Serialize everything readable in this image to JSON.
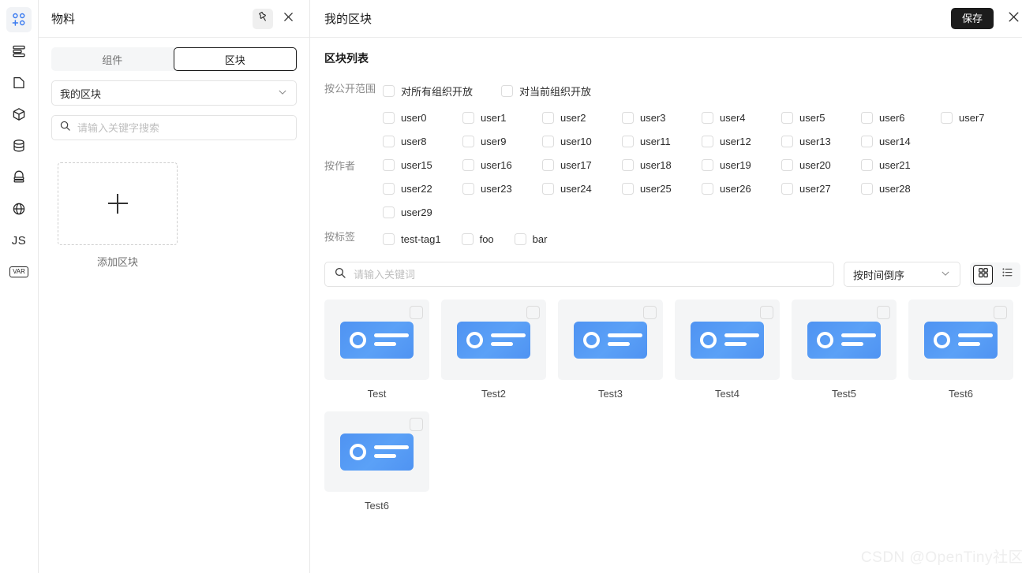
{
  "rail": {
    "items": [
      {
        "name": "material-add-icon",
        "label": "",
        "active": true
      },
      {
        "name": "layers-outline-icon",
        "label": "",
        "active": false
      },
      {
        "name": "page-icon",
        "label": "",
        "active": false
      },
      {
        "name": "cube-icon",
        "label": "",
        "active": false
      },
      {
        "name": "database-icon",
        "label": "",
        "active": false
      },
      {
        "name": "stack-icon",
        "label": "",
        "active": false
      },
      {
        "name": "globe-icon",
        "label": "",
        "active": false
      },
      {
        "name": "js-icon",
        "label": "JS",
        "active": false
      },
      {
        "name": "var-icon",
        "label": "VAR",
        "active": false
      }
    ]
  },
  "material_panel": {
    "title": "物料",
    "pin_icon": "pin-icon",
    "close_icon": "close-icon",
    "tabs": [
      {
        "label": "组件",
        "active": false
      },
      {
        "label": "区块",
        "active": true
      }
    ],
    "group_select": {
      "value": "我的区块",
      "caret_icon": "chevron-down-icon"
    },
    "search": {
      "value": "",
      "placeholder": "请输入关键字搜索",
      "icon": "search-icon"
    },
    "add_tile": {
      "plus_icon": "plus-icon",
      "label": "添加区块"
    }
  },
  "main_panel": {
    "title": "我的区块",
    "save_label": "保存",
    "close_icon": "close-icon",
    "section_title": "区块列表",
    "filters": [
      {
        "label": "按公开范围",
        "rows": [
          [
            "对所有组织开放",
            "对当前组织开放"
          ]
        ]
      },
      {
        "label": "按作者",
        "rows": [
          [
            "user0",
            "user1",
            "user2",
            "user3",
            "user4",
            "user5",
            "user6",
            "user7"
          ],
          [
            "user8",
            "user9",
            "user10",
            "user11",
            "user12",
            "user13",
            "user14"
          ],
          [
            "user15",
            "user16",
            "user17",
            "user18",
            "user19",
            "user20",
            "user21"
          ],
          [
            "user22",
            "user23",
            "user24",
            "user25",
            "user26",
            "user27",
            "user28"
          ],
          [
            "user29"
          ]
        ]
      },
      {
        "label": "按标签",
        "rows": [
          [
            "test-tag1",
            "foo",
            "bar"
          ]
        ]
      }
    ],
    "toolbar": {
      "search": {
        "value": "",
        "placeholder": "请输入关键词",
        "icon": "search-icon"
      },
      "sort": {
        "value": "按时间倒序",
        "caret_icon": "chevron-down-icon"
      },
      "view_grid_icon": "grid-view-icon",
      "view_list_icon": "list-view-icon",
      "active_view": "grid"
    },
    "cards": [
      {
        "label": "Test"
      },
      {
        "label": "Test2"
      },
      {
        "label": "Test3"
      },
      {
        "label": "Test4"
      },
      {
        "label": "Test5"
      },
      {
        "label": "Test6"
      },
      {
        "label": "Test6"
      }
    ]
  },
  "watermark": "CSDN @OpenTiny社区",
  "colors": {
    "accent_blue": "#4f93f2",
    "dark_button": "#1c1c1c",
    "thumb_bg": "#f4f5f6",
    "border": "#e3e3e3"
  }
}
